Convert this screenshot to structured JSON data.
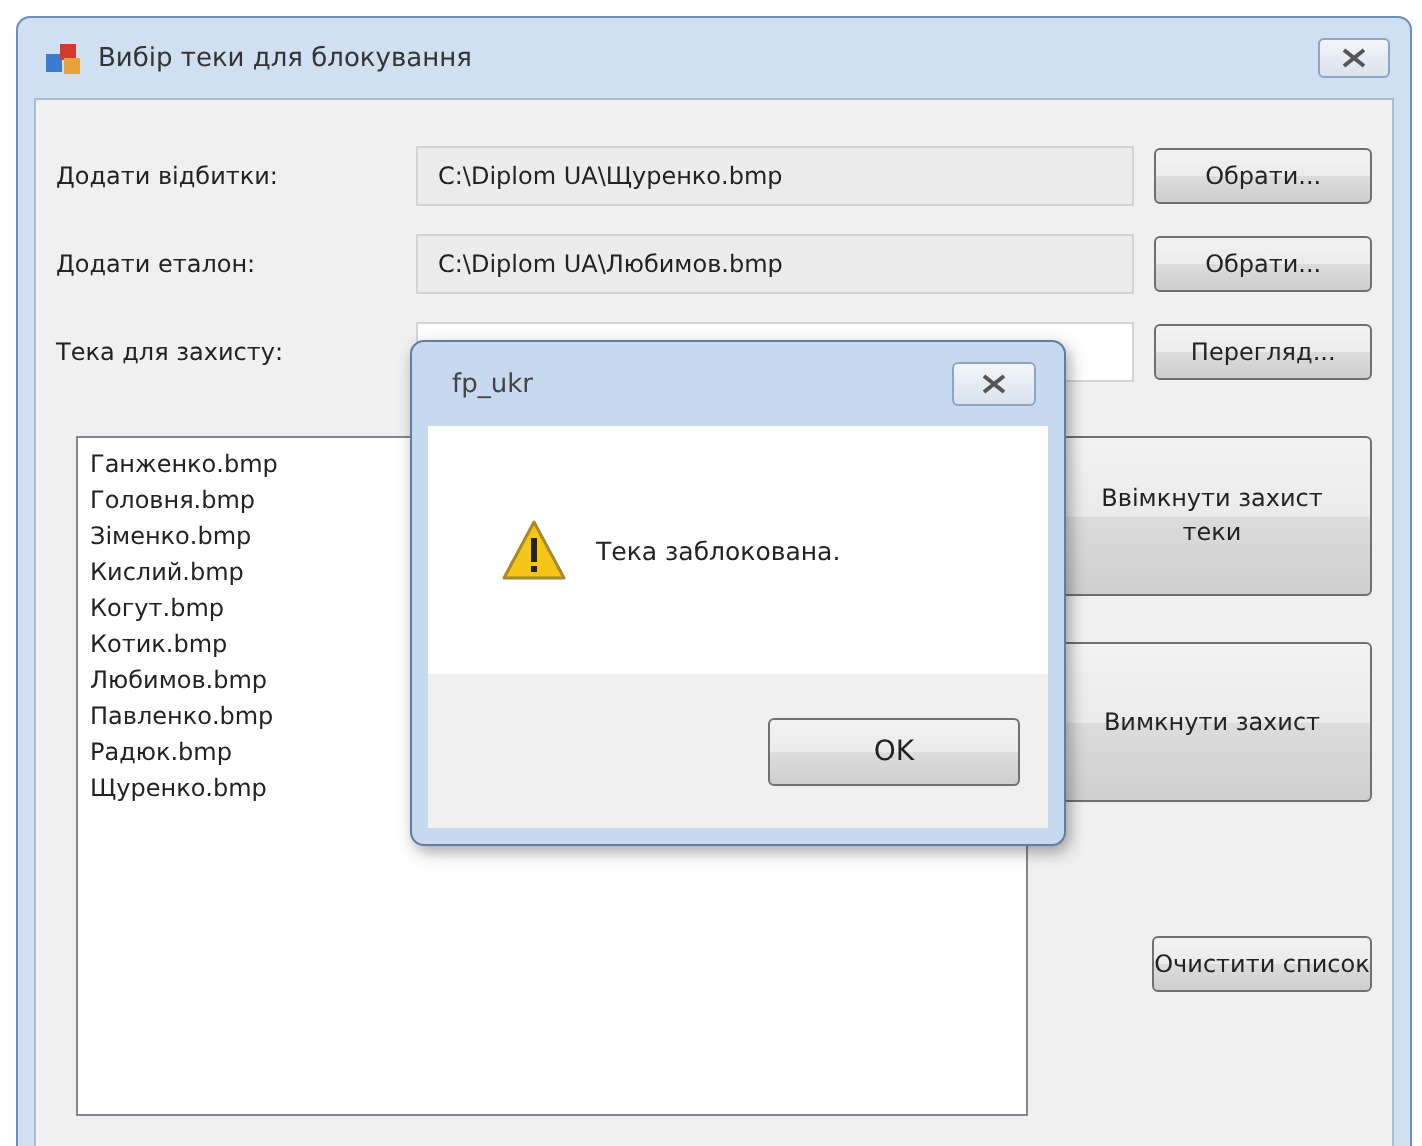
{
  "window": {
    "title": "Вибір теки для блокування"
  },
  "fields": [
    {
      "label": "Додати відбитки:",
      "value": "C:\\Diplom UA\\Щуренко.bmp",
      "button": "Обрати..."
    },
    {
      "label": "Додати еталон:",
      "value": "C:\\Diplom UA\\Любимов.bmp",
      "button": "Обрати..."
    },
    {
      "label": "Тека для захисту:",
      "button": "Перегляд..."
    }
  ],
  "file_list": [
    "Ганженко.bmp",
    "Головня.bmp",
    "Зіменко.bmp",
    "Кислий.bmp",
    "Когут.bmp",
    "Котик.bmp",
    "Любимов.bmp",
    "Павленко.bmp",
    "Радюк.bmp",
    "Щуренко.bmp"
  ],
  "side_buttons": [
    "Ввімкнути захист теки",
    "Вимкнути захист"
  ],
  "clear_button": "Очистити список",
  "dialog": {
    "title": "fp_ukr",
    "message": "Тека заблокована.",
    "button": "OK"
  }
}
